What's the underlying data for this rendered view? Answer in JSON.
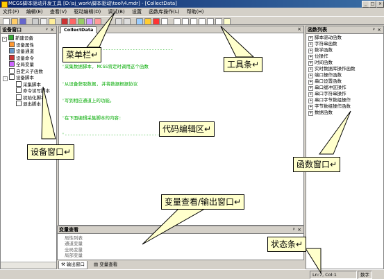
{
  "window": {
    "title": "MCGS脚本驱动开发工具 [D:\\sj_work\\脚本驱动\\tool\\4.mdr] - [CollectData]"
  },
  "menu": [
    "文件(F)",
    "编辑(E)",
    "查看(V)",
    "驱动编辑(D)",
    "调试(B)",
    "设置",
    "函数库操作(L)",
    "帮助(H)"
  ],
  "device_panel": {
    "title": "设备窗口",
    "items": [
      {
        "label": "新建设备",
        "level": 0
      },
      {
        "label": "设备属性",
        "level": 1
      },
      {
        "label": "设备通道",
        "level": 1
      },
      {
        "label": "设备命令",
        "level": 1
      },
      {
        "label": "全局变量",
        "level": 1
      },
      {
        "label": "自定义子函数",
        "level": 1
      },
      {
        "label": "设备脚本",
        "level": 1
      },
      {
        "label": "采集脚本",
        "level": 2
      },
      {
        "label": "命令读写脚本",
        "level": 2
      },
      {
        "label": "初始化脚本",
        "level": 2
      },
      {
        "label": "退出脚本",
        "level": 2
      }
    ]
  },
  "editor": {
    "tab": "CollectData",
    "lines": [
      "'----------------------------------------",
      "'采集数据脚本, MCGS将定时调用这个函数",
      "'从设备获取数据, 并将数据根据协议",
      "'写到相应通道上的功能。",
      "'在下面编辑采集脚本的内容:",
      "'----------------------------------------"
    ]
  },
  "function_panel": {
    "title": "函数列表",
    "items": [
      "脚本驱动函数",
      "字符串函数",
      "数学函数",
      "位操作",
      "时间函数",
      "实时数据库操作函数",
      "端口操作函数",
      "串口设置函数",
      "串口缓冲区操作",
      "串口字符串操作",
      "串口字节数组操作",
      "字节数组操作函数",
      "数据函数"
    ]
  },
  "output_panel": {
    "title": "变量查看",
    "items": [
      "局性列表",
      "通道变量",
      "全局变量",
      "局部变量"
    ]
  },
  "bottom_tabs": [
    "输出窗口",
    "变量查看"
  ],
  "status": {
    "position": "Ln:7, Col:1",
    "mode": "数字"
  },
  "callouts": {
    "menubar": "菜单栏",
    "toolbar": "工具条",
    "editor": "代码编辑区",
    "device": "设备窗口",
    "function": "函数窗口",
    "output": "变量查看/输出窗口",
    "status": "状态条"
  }
}
